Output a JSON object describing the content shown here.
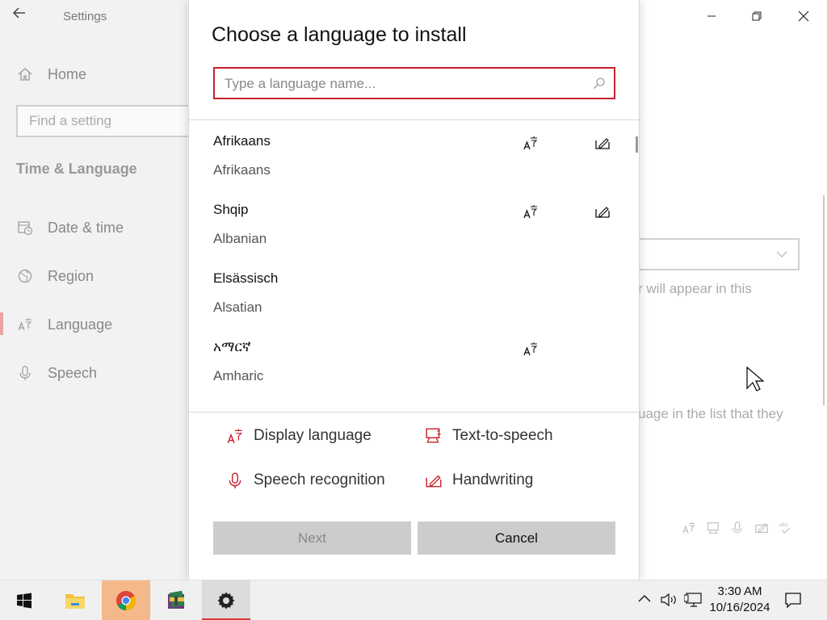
{
  "window": {
    "app_title": "Settings",
    "minimize_label": "—",
    "maximize_label": "□",
    "close_label": "✕"
  },
  "sidebar": {
    "home_label": "Home",
    "search_placeholder": "Find a setting",
    "section_heading": "Time & Language",
    "items": [
      {
        "label": "Date & time",
        "icon": "calendar-clock-icon"
      },
      {
        "label": "Region",
        "icon": "globe-icon"
      },
      {
        "label": "Language",
        "icon": "language-icon",
        "active": true
      },
      {
        "label": "Speech",
        "icon": "microphone-icon"
      }
    ]
  },
  "background": {
    "text_fragment_1": "r will appear in this",
    "text_fragment_2": "uage in the list that they"
  },
  "dialog": {
    "title": "Choose a language to install",
    "search_placeholder": "Type a language name...",
    "languages": [
      {
        "native": "Afrikaans",
        "english": "Afrikaans",
        "display_language": true,
        "handwriting": true
      },
      {
        "native": "Shqip",
        "english": "Albanian",
        "display_language": true,
        "handwriting": true
      },
      {
        "native": "Elsässisch",
        "english": "Alsatian",
        "display_language": false,
        "handwriting": false
      },
      {
        "native": "አማርኛ",
        "english": "Amharic",
        "display_language": true,
        "handwriting": false
      }
    ],
    "legend": {
      "display_language": "Display language",
      "text_to_speech": "Text-to-speech",
      "speech_recognition": "Speech recognition",
      "handwriting": "Handwriting"
    },
    "next_label": "Next",
    "cancel_label": "Cancel"
  },
  "taskbar": {
    "time": "3:30 AM",
    "date": "10/16/2024"
  },
  "colors": {
    "accent": "#c8202a",
    "button_bg": "#cccccc",
    "sidebar_bg": "#f2f2f2",
    "taskbar_bg": "#f0f0f0"
  }
}
